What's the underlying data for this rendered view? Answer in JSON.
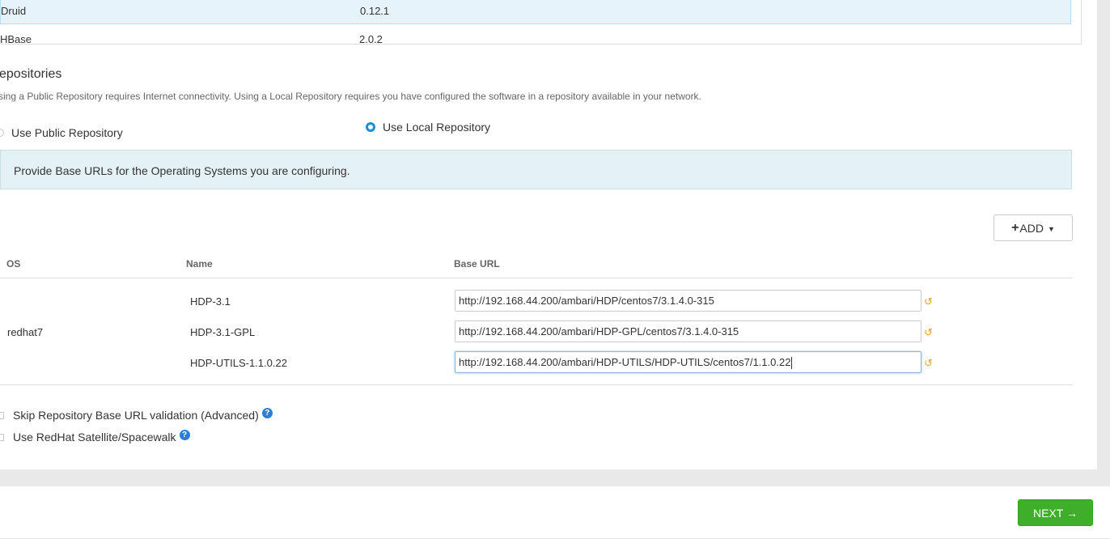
{
  "services": [
    {
      "name": "Druid",
      "version": "0.12.1"
    },
    {
      "name": "HBase",
      "version": "2.0.2"
    }
  ],
  "repositories": {
    "title": "epositories",
    "description": "sing a Public Repository requires Internet connectivity. Using a Local Repository requires you have configured the software in a repository available in your network.",
    "public_label": "Use Public Repository",
    "local_label": "Use Local Repository",
    "selected": "local",
    "alert": "Provide Base URLs for the Operating Systems you are configuring.",
    "add_label": "ADD",
    "columns": {
      "os": "OS",
      "name": "Name",
      "base_url": "Base URL"
    },
    "os": "redhat7",
    "rows": [
      {
        "name": "HDP-3.1",
        "url": "http://192.168.44.200/ambari/HDP/centos7/3.1.4.0-315"
      },
      {
        "name": "HDP-3.1-GPL",
        "url": "http://192.168.44.200/ambari/HDP-GPL/centos7/3.1.4.0-315"
      },
      {
        "name": "HDP-UTILS-1.1.0.22",
        "url": "http://192.168.44.200/ambari/HDP-UTILS/HDP-UTILS/centos7/1.1.0.22"
      }
    ],
    "skip_validation_label": "Skip Repository Base URL validation (Advanced)",
    "satellite_label": "Use RedHat Satellite/Spacewalk"
  },
  "footer": {
    "next_label": "NEXT →"
  },
  "colors": {
    "accent": "#1f8dd6",
    "next": "#3fae2a",
    "undo": "#f0a223",
    "help": "#2a7fd4"
  }
}
